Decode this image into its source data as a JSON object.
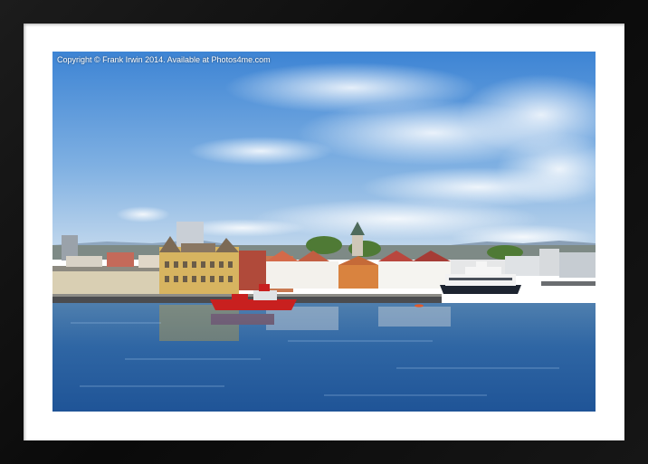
{
  "watermark": {
    "text": "Copyright © Frank Irwin 2014. Available at Photos4me.com"
  },
  "colors": {
    "frame": "#111111",
    "mat": "#ffffff",
    "sky_top": "#3f86d6",
    "sky_bottom": "#bcd6ee",
    "water": "#2a5f9e",
    "tugboat": "#c8201f",
    "ferry": "#f2f2f2"
  },
  "scene": {
    "subject": "harbour-town-waterfront",
    "elements": [
      "sky",
      "clouds",
      "buildings",
      "church-tower",
      "tugboat",
      "ferry",
      "kayak",
      "water"
    ]
  }
}
